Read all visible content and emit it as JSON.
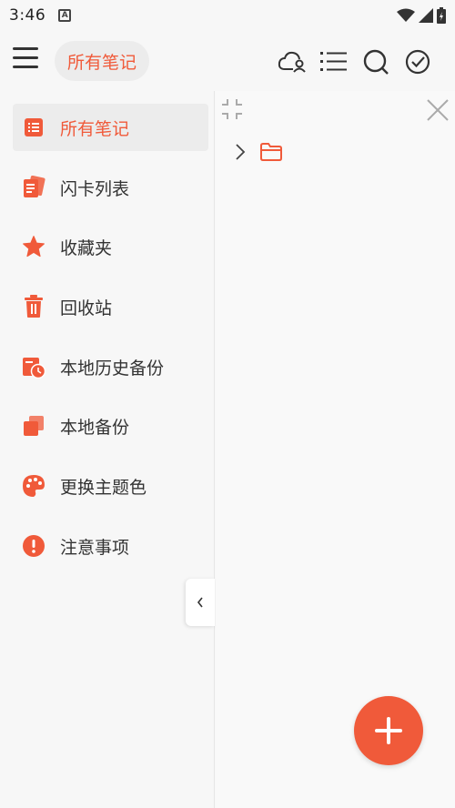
{
  "status_bar": {
    "time": "3:46",
    "a_badge": "A"
  },
  "header": {
    "title": "所有笔记",
    "icons": [
      "cloud-user-icon",
      "list-icon",
      "search-icon",
      "check-circle-icon"
    ]
  },
  "sidebar": {
    "items": [
      {
        "label": "所有笔记",
        "icon": "notes-list-icon",
        "active": true
      },
      {
        "label": "闪卡列表",
        "icon": "flashcards-icon"
      },
      {
        "label": "收藏夹",
        "icon": "star-icon"
      },
      {
        "label": "回收站",
        "icon": "trash-icon"
      },
      {
        "label": "本地历史备份",
        "icon": "history-backup-icon"
      },
      {
        "label": "本地备份",
        "icon": "backup-icon"
      },
      {
        "label": "更换主题色",
        "icon": "palette-icon"
      },
      {
        "label": "注意事项",
        "icon": "alert-icon"
      }
    ]
  },
  "colors": {
    "accent": "#f05a3a",
    "text": "#333333",
    "background": "#f7f7f7"
  }
}
